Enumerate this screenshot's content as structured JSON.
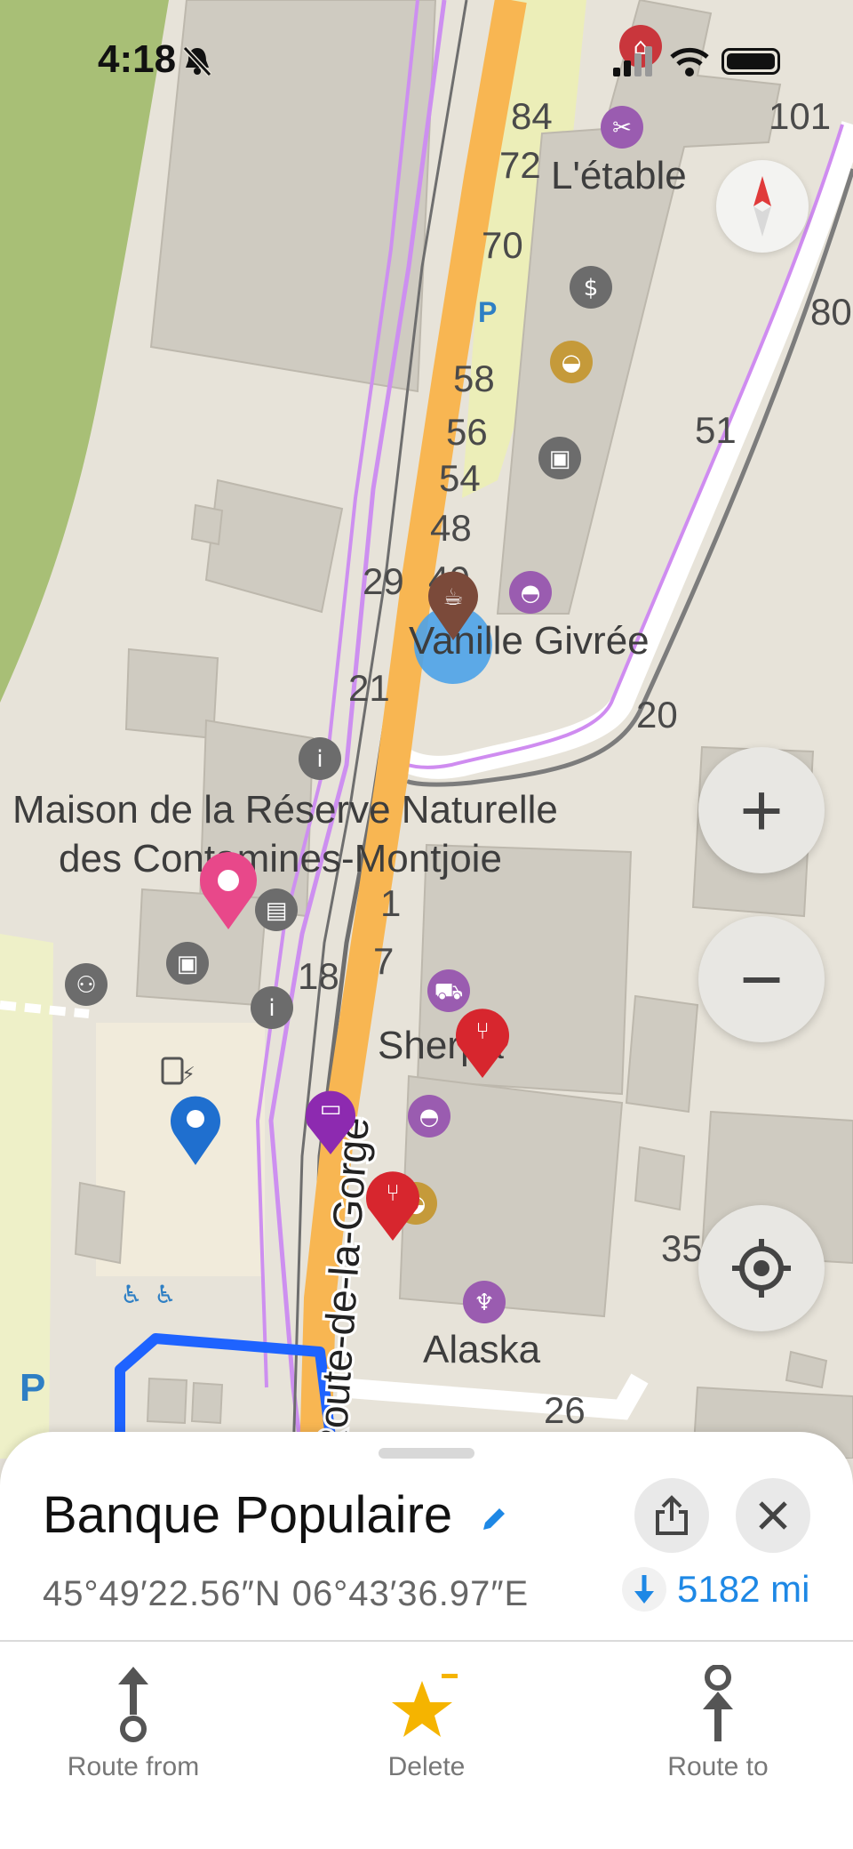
{
  "status_bar": {
    "time": "4:18"
  },
  "map": {
    "labels": {
      "letable": "L'étable",
      "vanille": "Vanille Givrée",
      "maison_1": "Maison de la Réserve Naturelle",
      "maison_2": "des Contamines-Montjoie",
      "sherpa": "Sherpa",
      "alaska": "Alaska",
      "road": "Route-de-la-Gorge"
    },
    "house_numbers": [
      "84",
      "72",
      "70",
      "58",
      "56",
      "54",
      "48",
      "40",
      "29",
      "21",
      "51",
      "20",
      "18",
      "1",
      "7",
      "101",
      "80",
      "35",
      "26"
    ],
    "parking_label": "P"
  },
  "controls": {
    "zoom_in": "+",
    "zoom_out": "−"
  },
  "place_sheet": {
    "title": "Banque Populaire",
    "coordinates": "45°49′22.56″N 06°43′36.97″E",
    "distance": "5182 mi"
  },
  "actions": {
    "route_from": "Route from",
    "delete": "Delete",
    "route_to": "Route to"
  },
  "colors": {
    "accent": "#1e88e5",
    "road_primary": "#f8b652",
    "star": "#f5b400",
    "route_blue": "#1e63ff"
  }
}
